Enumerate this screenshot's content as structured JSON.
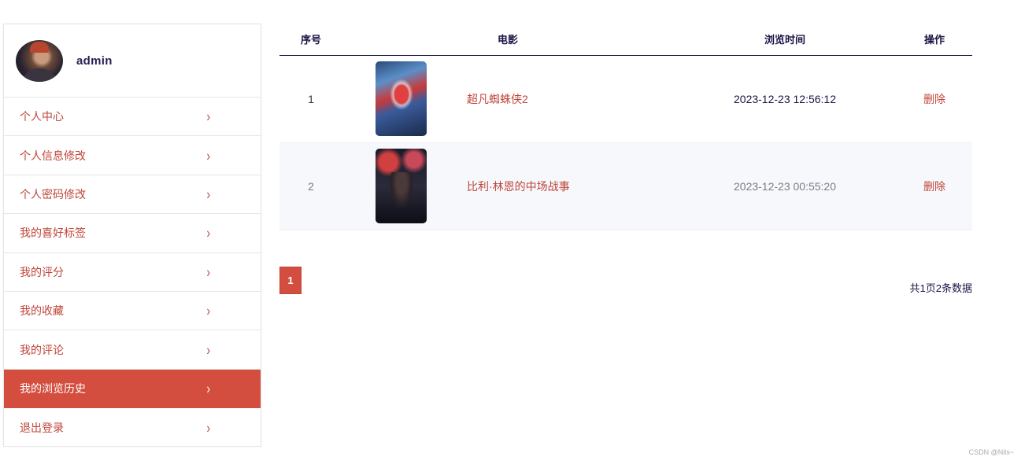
{
  "user": {
    "name": "admin"
  },
  "menu": [
    {
      "label": "个人中心",
      "active": false
    },
    {
      "label": "个人信息修改",
      "active": false
    },
    {
      "label": "个人密码修改",
      "active": false
    },
    {
      "label": "我的喜好标签",
      "active": false
    },
    {
      "label": "我的评分",
      "active": false
    },
    {
      "label": "我的收藏",
      "active": false
    },
    {
      "label": "我的评论",
      "active": false
    },
    {
      "label": "我的浏览历史",
      "active": true
    },
    {
      "label": "退出登录",
      "active": false
    }
  ],
  "chevron": "›",
  "table": {
    "headers": {
      "index": "序号",
      "movie": "电影",
      "time": "浏览时间",
      "action": "操作"
    },
    "rows": [
      {
        "index": "1",
        "title": "超凡蜘蛛侠2",
        "time": "2023-12-23 12:56:12",
        "action": "删除"
      },
      {
        "index": "2",
        "title": "比利·林恩的中场战事",
        "time": "2023-12-23 00:55:20",
        "action": "删除"
      }
    ]
  },
  "pagination": {
    "current": "1",
    "summary": "共1页2条数据"
  },
  "watermark": "CSDN @Nils~",
  "colors": {
    "accent": "#d34e3e",
    "link": "#c0453a",
    "heading": "#1d1446"
  }
}
